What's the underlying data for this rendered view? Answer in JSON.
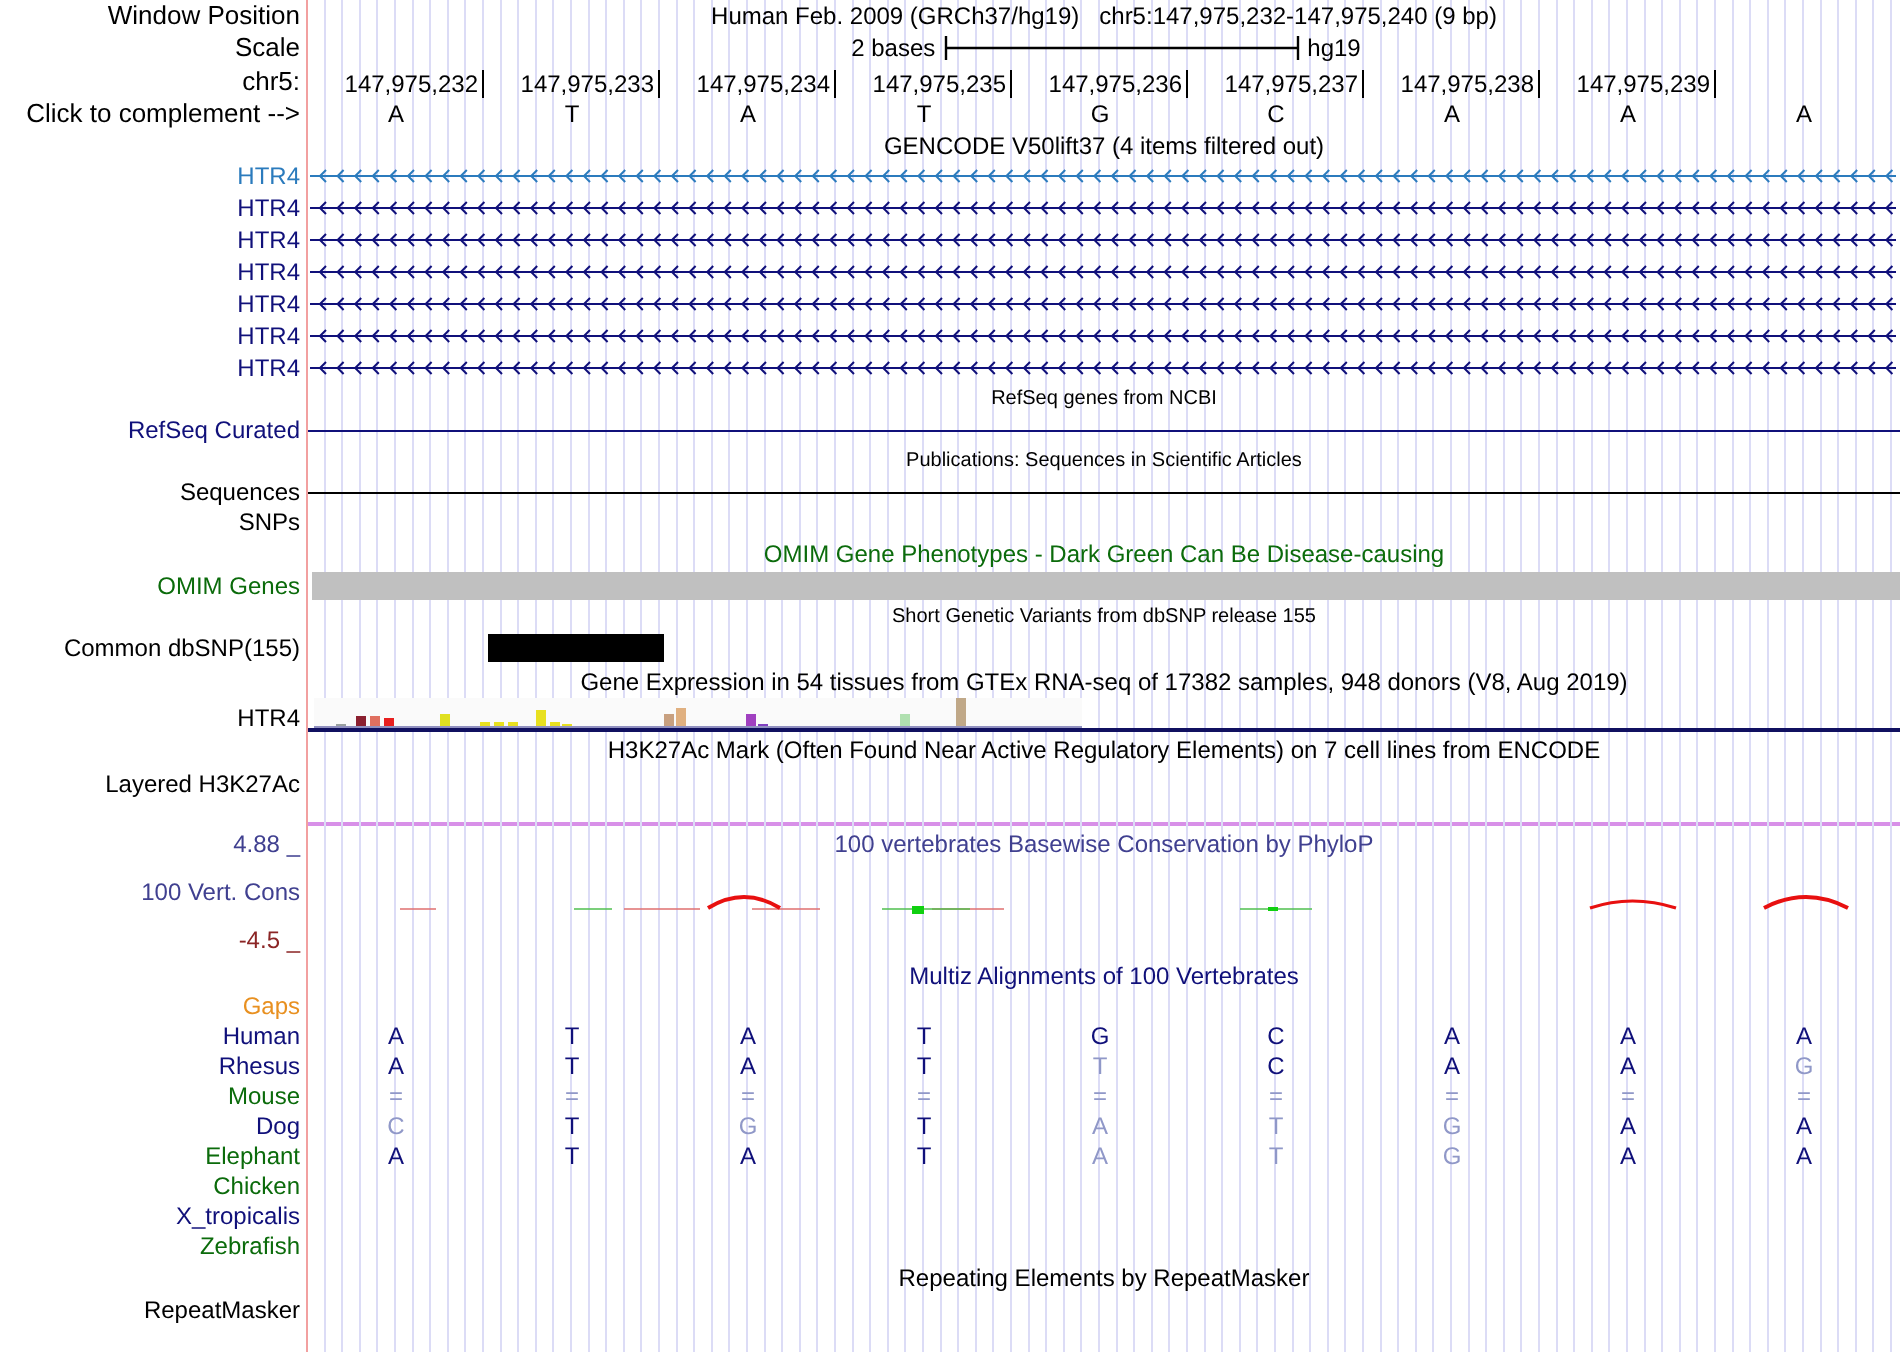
{
  "header": {
    "window_position_label": "Window Position",
    "assembly_title": "Human Feb. 2009 (GRCh37/hg19)",
    "position_title": "chr5:147,975,232-147,975,240 (9 bp)",
    "scale_label": "Scale",
    "scale_text": "2 bases",
    "scale_assembly": "hg19",
    "chrom_label": "chr5:",
    "positions": [
      "147,975,232",
      "147,975,233",
      "147,975,234",
      "147,975,235",
      "147,975,236",
      "147,975,237",
      "147,975,238",
      "147,975,239"
    ],
    "complement_label": "Click to complement -->",
    "bases": [
      "A",
      "T",
      "A",
      "T",
      "G",
      "C",
      "A",
      "A",
      "A"
    ]
  },
  "tracks": [
    {
      "kind": "genes",
      "title": "GENCODE V50lift37 (4 items filtered out)",
      "items": [
        {
          "label": "HTR4",
          "color": "#2b7bbd"
        },
        {
          "label": "HTR4",
          "color": "#10107a"
        },
        {
          "label": "HTR4",
          "color": "#10107a"
        },
        {
          "label": "HTR4",
          "color": "#10107a"
        },
        {
          "label": "HTR4",
          "color": "#10107a"
        },
        {
          "label": "HTR4",
          "color": "#10107a"
        },
        {
          "label": "HTR4",
          "color": "#10107a"
        }
      ]
    },
    {
      "kind": "line",
      "title": "RefSeq genes from NCBI",
      "label": "RefSeq Curated",
      "color": "#10107a"
    },
    {
      "kind": "line",
      "title": "Publications: Sequences in Scientific Articles",
      "label": "Sequences",
      "color": "#000000"
    },
    {
      "kind": "empty",
      "label": "SNPs"
    },
    {
      "kind": "omim",
      "title": "OMIM Gene Phenotypes - Dark Green Can Be Disease-causing",
      "label": "OMIM Genes"
    },
    {
      "kind": "snp",
      "title": "Short Genetic Variants from dbSNP release 155",
      "label": "Common dbSNP(155)"
    },
    {
      "kind": "expression",
      "title": "Gene Expression in 54 tissues from GTEx RNA-seq of 17382 samples, 948 donors (V8, Aug 2019)",
      "label": "HTR4"
    },
    {
      "kind": "layered",
      "title": "H3K27Ac Mark (Often Found Near Active Regulatory Elements) on 7 cell lines from ENCODE",
      "label": "Layered H3K27Ac"
    },
    {
      "kind": "conservation",
      "title": "100 vertebrates Basewise Conservation by PhyloP",
      "label": "100 Vert. Cons",
      "max_label": "4.88 _",
      "min_label": "-4.5 _"
    },
    {
      "kind": "alignment",
      "title": "Multiz Alignments of 100 Vertebrates",
      "gaps_label": "Gaps",
      "species": [
        {
          "label": "Human",
          "color": "#10107a",
          "bases": [
            {
              "base": "A",
              "faded": false
            },
            {
              "base": "T",
              "faded": false
            },
            {
              "base": "A",
              "faded": false
            },
            {
              "base": "T",
              "faded": false
            },
            {
              "base": "G",
              "faded": false
            },
            {
              "base": "C",
              "faded": false
            },
            {
              "base": "A",
              "faded": false
            },
            {
              "base": "A",
              "faded": false
            },
            {
              "base": "A",
              "faded": false
            }
          ]
        },
        {
          "label": "Rhesus",
          "color": "#10107a",
          "bases": [
            {
              "base": "A",
              "faded": false
            },
            {
              "base": "T",
              "faded": false
            },
            {
              "base": "A",
              "faded": false
            },
            {
              "base": "T",
              "faded": false
            },
            {
              "base": "T",
              "faded": true
            },
            {
              "base": "C",
              "faded": false
            },
            {
              "base": "A",
              "faded": false
            },
            {
              "base": "A",
              "faded": false
            },
            {
              "base": "G",
              "faded": true
            }
          ]
        },
        {
          "label": "Mouse",
          "color": "#0b6b0b",
          "bases": [
            {
              "base": "=",
              "faded": true
            },
            {
              "base": "=",
              "faded": true
            },
            {
              "base": "=",
              "faded": true
            },
            {
              "base": "=",
              "faded": true
            },
            {
              "base": "=",
              "faded": true
            },
            {
              "base": "=",
              "faded": true
            },
            {
              "base": "=",
              "faded": true
            },
            {
              "base": "=",
              "faded": true
            },
            {
              "base": "=",
              "faded": true
            }
          ]
        },
        {
          "label": "Dog",
          "color": "#10107a",
          "bases": [
            {
              "base": "C",
              "faded": true
            },
            {
              "base": "T",
              "faded": false
            },
            {
              "base": "G",
              "faded": true
            },
            {
              "base": "T",
              "faded": false
            },
            {
              "base": "A",
              "faded": true
            },
            {
              "base": "T",
              "faded": true
            },
            {
              "base": "G",
              "faded": true
            },
            {
              "base": "A",
              "faded": false
            },
            {
              "base": "A",
              "faded": false
            }
          ]
        },
        {
          "label": "Elephant",
          "color": "#0b6b0b",
          "bases": [
            {
              "base": "A",
              "faded": false
            },
            {
              "base": "T",
              "faded": false
            },
            {
              "base": "A",
              "faded": false
            },
            {
              "base": "T",
              "faded": false
            },
            {
              "base": "A",
              "faded": true
            },
            {
              "base": "T",
              "faded": true
            },
            {
              "base": "G",
              "faded": true
            },
            {
              "base": "A",
              "faded": false
            },
            {
              "base": "A",
              "faded": false
            }
          ]
        },
        {
          "label": "Chicken",
          "color": "#0b6b0b"
        },
        {
          "label": "X_tropicalis",
          "color": "#10107a"
        },
        {
          "label": "Zebrafish",
          "color": "#0b6b0b"
        }
      ]
    },
    {
      "kind": "repeat",
      "title": "Repeating Elements by RepeatMasker",
      "label": "RepeatMasker"
    }
  ]
}
